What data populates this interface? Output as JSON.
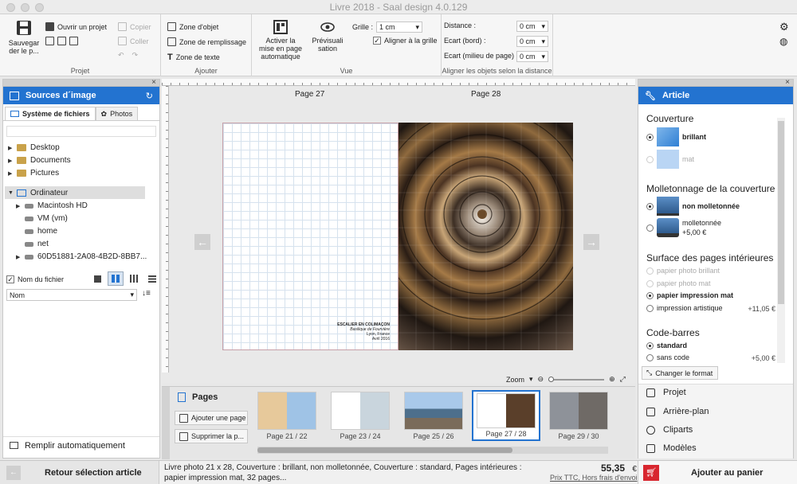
{
  "window": {
    "title": "Livre 2018 - Saal design 4.0.129"
  },
  "ribbon": {
    "projet": {
      "save_label_1": "Sauvegar",
      "save_label_2": "der le p...",
      "open": "Ouvrir un projet",
      "copy": "Copier",
      "paste": "Coller",
      "group": "Projet"
    },
    "ajouter": {
      "object_zone": "Zone d'objet",
      "fill_zone": "Zone de remplissage",
      "text_zone": "Zone de texte",
      "group": "Ajouter"
    },
    "vue": {
      "auto_layout_1": "Activer la",
      "auto_layout_2": "mise en page",
      "auto_layout_3": "automatique",
      "preview_1": "Prévisuali",
      "preview_2": "sation",
      "grid_label": "Grille :",
      "grid_value": "1 cm",
      "snap_label": "Aligner à la grille",
      "group": "Vue"
    },
    "align": {
      "distance_label": "Distance :",
      "distance_value": "0 cm",
      "edge_label": "Ecart (bord) :",
      "edge_value": "0 cm",
      "mid_label": "Ecart (milieu de page) :",
      "mid_value": "0 cm",
      "group": "Aligner les objets selon la distance"
    }
  },
  "left_panel": {
    "header": "Sources d´image",
    "tab_files": "Système de fichiers",
    "tab_photos": "Photos",
    "tree": [
      {
        "label": "Desktop"
      },
      {
        "label": "Documents"
      },
      {
        "label": "Pictures"
      },
      {
        "label": "Ordinateur"
      },
      {
        "label": "Macintosh HD"
      },
      {
        "label": "VM (vm)"
      },
      {
        "label": "home"
      },
      {
        "label": "net"
      },
      {
        "label": "60D51881-2A08-4B2D-8BB7..."
      }
    ],
    "show_filename": "Nom du fichier",
    "sort_value": "Nom",
    "autofill": "Remplir automatiquement",
    "back": "Retour sélection article"
  },
  "canvas": {
    "page_left_label": "Page 27",
    "page_right_label": "Page 28",
    "caption_title": "ESCALIER EN COLIMAÇON",
    "caption_sub": "Basilique de Fourvière",
    "caption_place": "Lyon, France",
    "caption_date": "Avril 2016",
    "zoom_label": "Zoom"
  },
  "pages_tray": {
    "title": "Pages",
    "add": "Ajouter une page",
    "remove": "Supprimer la p...",
    "thumbs": [
      {
        "label": "Page 21 / 22"
      },
      {
        "label": "Page 23 / 24"
      },
      {
        "label": "Page 25 / 26"
      },
      {
        "label": "Page 27 / 28"
      },
      {
        "label": "Page 29 / 30"
      }
    ]
  },
  "right_panel": {
    "header": "Article",
    "cover_title": "Couverture",
    "cover_glossy": "brillant",
    "cover_matte": "mat",
    "padding_title": "Molletonnage de la couverture",
    "padding_none": "non molletonnée",
    "padding_yes": "molletonnée",
    "padding_price": "+5,00 €",
    "surface_title": "Surface des pages intérieures",
    "surface_1": "papier photo brillant",
    "surface_2": "papier photo mat",
    "surface_3": "papier impression mat",
    "surface_4": "impression artistique",
    "surface_4_price": "+11,05 €",
    "barcode_title": "Code-barres",
    "barcode_std": "standard",
    "barcode_none": "sans code",
    "barcode_price": "+5,00 €",
    "change_format": "Changer le format",
    "nav": [
      "Projet",
      "Arrière-plan",
      "Cliparts",
      "Modèles"
    ],
    "add_cart": "Ajouter au panier"
  },
  "status": {
    "line1": "Livre photo 21 x 28, Couverture : brillant, non molletonnée, Couverture : standard, Pages intérieures :",
    "line2": "papier impression mat, 32 pages...",
    "price": "55,35",
    "currency": "€",
    "price_note": "Prix TTC, Hors frais d'envoi"
  },
  "colors": {
    "accent": "#2373d0",
    "cart_icon": "#d8262f"
  }
}
